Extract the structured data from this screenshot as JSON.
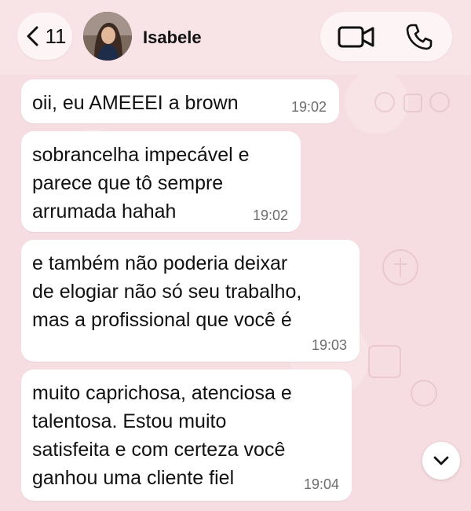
{
  "header": {
    "back_count": "11",
    "contact_name": "Isabele"
  },
  "icons": {
    "back": "chevron-left-icon",
    "video": "video-camera-icon",
    "phone": "phone-icon",
    "scroll": "chevron-down-icon"
  },
  "colors": {
    "wallpaper": "#f6dde2",
    "bubble": "#ffffff",
    "timestamp": "#6d6d6d"
  },
  "messages": [
    {
      "text": "oii, eu AMEEEI a brown",
      "time": "19:02"
    },
    {
      "text": "sobrancelha impecável e\nparece que tô sempre\narrumada hahah",
      "time": "19:02"
    },
    {
      "text": "e também não poderia deixar\nde elogiar não só seu trabalho,\nmas a profissional que você é",
      "time": "19:03"
    },
    {
      "text": "muito caprichosa, atenciosa e\ntalentosa. Estou muito\nsatisfeita e com certeza você\nganhou uma cliente fiel",
      "time": "19:04"
    }
  ]
}
